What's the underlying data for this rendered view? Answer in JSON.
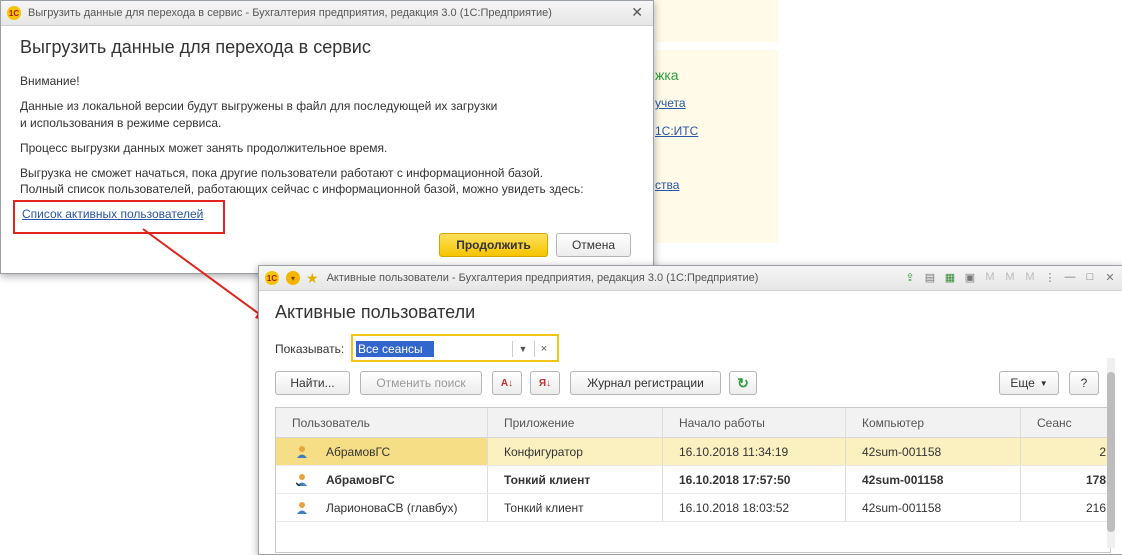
{
  "background": {
    "heading": "жка",
    "links": [
      "учета",
      "1С:ИТС",
      "",
      "ства"
    ]
  },
  "dialog": {
    "window_title": "Выгрузить данные для перехода в сервис - Бухгалтерия предприятия, редакция 3.0  (1С:Предприятие)",
    "heading": "Выгрузить данные для перехода в сервис",
    "attention": "Внимание!",
    "para1_line1": "Данные из локальной версии будут выгружены в файл для последующей их загрузки",
    "para1_line2": "и использования в режиме сервиса.",
    "para2": "Процесс выгрузки данных может занять продолжительное время.",
    "para3_line1": "Выгрузка не сможет начаться, пока другие пользователи работают с информационной базой.",
    "para3_line2": "Полный список пользователей, работающих сейчас с информационной базой, можно увидеть здесь:",
    "link": "Список активных пользователей",
    "continue": "Продолжить",
    "cancel": "Отмена",
    "annotation_color": "#e0241e"
  },
  "users_window": {
    "window_title": "Активные пользователи - Бухгалтерия предприятия, редакция 3.0  (1С:Предприятие)",
    "heading": "Активные пользователи",
    "filter_label": "Показывать:",
    "filter_value": "Все сеансы",
    "toolbar": {
      "find": "Найти...",
      "cancel_search": "Отменить поиск",
      "journal": "Журнал регистрации",
      "more": "Еще",
      "help": "?"
    },
    "columns": [
      "Пользователь",
      "Приложение",
      "Начало работы",
      "Компьютер",
      "Сеанс"
    ],
    "rows": [
      {
        "user": "АбрамовГС",
        "app": "Конфигуратор",
        "start": "16.10.2018 11:34:19",
        "computer": "42sum-001158",
        "session": "2"
      },
      {
        "user": "АбрамовГС",
        "app": "Тонкий клиент",
        "start": "16.10.2018 17:57:50",
        "computer": "42sum-001158",
        "session": "178"
      },
      {
        "user": "ЛарионоваСВ (главбух)",
        "app": "Тонкий клиент",
        "start": "16.10.2018 18:03:52",
        "computer": "42sum-001158",
        "session": "216"
      }
    ],
    "accent": "#f0c419"
  }
}
